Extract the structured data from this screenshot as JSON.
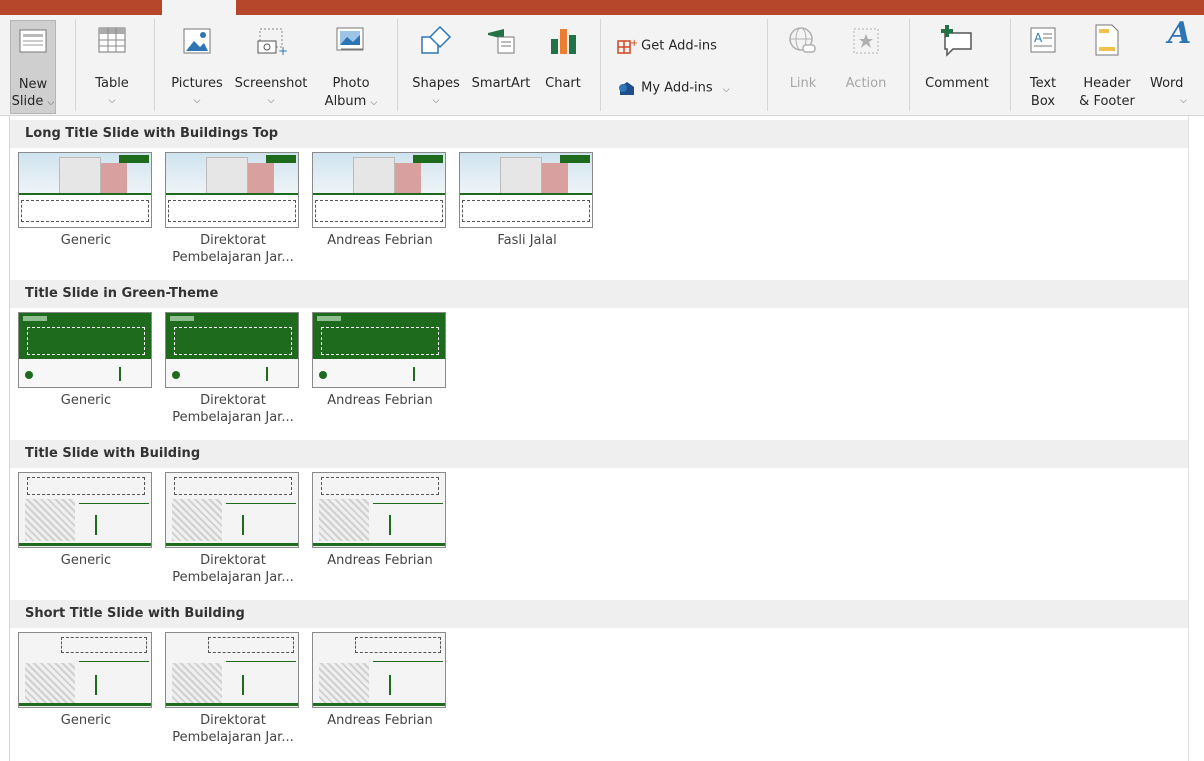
{
  "ribbon": {
    "new_slide": {
      "line1": "New",
      "line2": "Slide",
      "icon": "new-slide-icon"
    },
    "table": {
      "label": "Table",
      "icon": "table-icon"
    },
    "pictures": {
      "label": "Pictures",
      "icon": "pictures-icon"
    },
    "screenshot": {
      "label": "Screenshot",
      "icon": "screenshot-icon"
    },
    "photo_album": {
      "line1": "Photo",
      "line2": "Album",
      "icon": "photo-album-icon"
    },
    "shapes": {
      "label": "Shapes",
      "icon": "shapes-icon"
    },
    "smartart": {
      "label": "SmartArt",
      "icon": "smartart-icon"
    },
    "chart": {
      "label": "Chart",
      "icon": "chart-icon"
    },
    "get_addins": {
      "label": "Get Add-ins",
      "icon": "get-addins-icon"
    },
    "my_addins": {
      "label": "My Add-ins",
      "icon": "my-addins-icon"
    },
    "link": {
      "label": "Link",
      "icon": "link-icon"
    },
    "action": {
      "label": "Action",
      "icon": "action-icon"
    },
    "comment": {
      "label": "Comment",
      "icon": "comment-icon"
    },
    "text_box": {
      "line1": "Text",
      "line2": "Box",
      "icon": "text-box-icon"
    },
    "header_footer": {
      "line1": "Header",
      "line2": "& Footer",
      "icon": "header-footer-icon"
    },
    "wordart": {
      "label": "Word",
      "icon": "wordart-icon"
    }
  },
  "colors": {
    "title_bar": "#b7472a",
    "theme_green": "#1e6b1e"
  },
  "sections": [
    {
      "title": "Long Title Slide with Buildings Top",
      "layouts": [
        {
          "line1": "Generic",
          "line2": ""
        },
        {
          "line1": "Direktorat",
          "line2": "Pembelajaran Jar..."
        },
        {
          "line1": "Andreas Febrian",
          "line2": ""
        },
        {
          "line1": "Fasli Jalal",
          "line2": ""
        }
      ]
    },
    {
      "title": "Title Slide in Green-Theme",
      "layouts": [
        {
          "line1": "Generic",
          "line2": ""
        },
        {
          "line1": "Direktorat",
          "line2": "Pembelajaran Jar..."
        },
        {
          "line1": "Andreas Febrian",
          "line2": ""
        }
      ]
    },
    {
      "title": "Title Slide with Building",
      "layouts": [
        {
          "line1": "Generic",
          "line2": ""
        },
        {
          "line1": "Direktorat",
          "line2": "Pembelajaran Jar..."
        },
        {
          "line1": "Andreas Febrian",
          "line2": ""
        }
      ]
    },
    {
      "title": "Short Title Slide with Building",
      "layouts": [
        {
          "line1": "Generic",
          "line2": ""
        },
        {
          "line1": "Direktorat",
          "line2": "Pembelajaran Jar..."
        },
        {
          "line1": "Andreas Febrian",
          "line2": ""
        }
      ]
    }
  ]
}
